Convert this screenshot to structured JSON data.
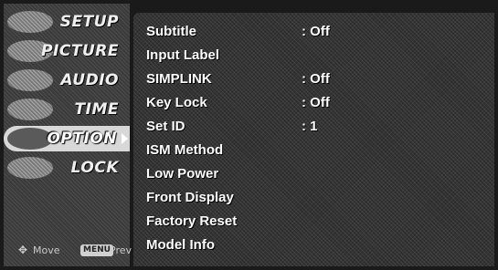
{
  "sidebar": {
    "items": [
      {
        "label": "SETUP",
        "icon": "setup-thumb-icon"
      },
      {
        "label": "PICTURE",
        "icon": "picture-thumb-icon"
      },
      {
        "label": "AUDIO",
        "icon": "audio-thumb-icon"
      },
      {
        "label": "TIME",
        "icon": "time-thumb-icon"
      },
      {
        "label": "OPTION",
        "icon": "option-thumb-icon",
        "selected": true
      },
      {
        "label": "LOCK",
        "icon": "lock-thumb-icon"
      }
    ],
    "footer": {
      "move_label": "Move",
      "menu_key": "MENU",
      "prev_label": "Prev"
    }
  },
  "option_menu": {
    "rows": [
      {
        "label": "Subtitle",
        "value": ": Off"
      },
      {
        "label": "Input Label",
        "value": ""
      },
      {
        "label": "SIMPLINK",
        "value": ": Off"
      },
      {
        "label": "Key Lock",
        "value": ": Off"
      },
      {
        "label": "Set ID",
        "value": ": 1"
      },
      {
        "label": "ISM Method",
        "value": ""
      },
      {
        "label": "Low Power",
        "value": ""
      },
      {
        "label": "Front Display",
        "value": ""
      },
      {
        "label": "Factory Reset",
        "value": ""
      },
      {
        "label": "Model Info",
        "value": ""
      }
    ]
  },
  "colors": {
    "text": "#ffffff",
    "panel_bg": "#2c2c2c",
    "sidebar_bg": "#3a3a3a",
    "selected_bg": "#d8d8d8"
  }
}
